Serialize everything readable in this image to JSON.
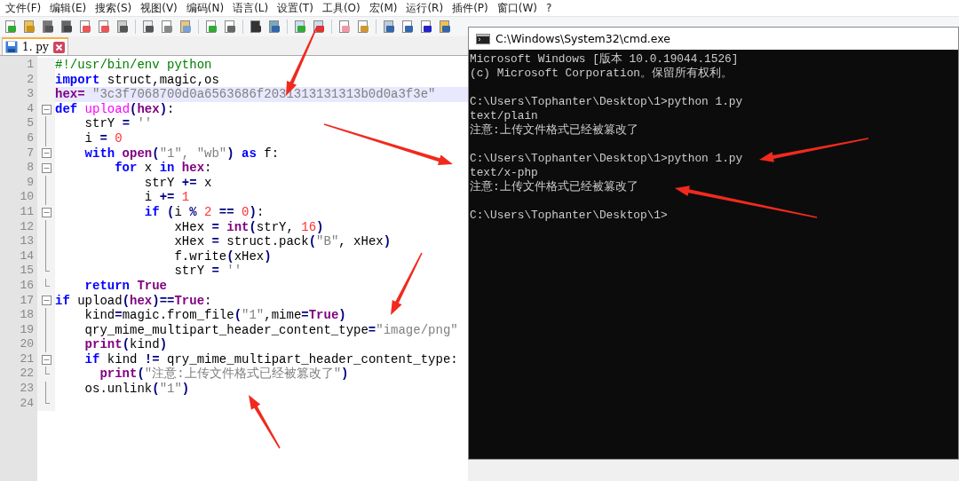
{
  "menu": [
    "文件(F)",
    "编辑(E)",
    "搜索(S)",
    "视图(V)",
    "编码(N)",
    "语言(L)",
    "设置(T)",
    "工具(O)",
    "宏(M)",
    "运行(R)",
    "插件(P)",
    "窗口(W)",
    "?"
  ],
  "tabs": [
    {
      "label": "1. py",
      "selected": true
    }
  ],
  "editor": {
    "lines": [
      {
        "number": "1",
        "fold_box": false,
        "fold_end": false,
        "selected": false,
        "tokens": [
          {
            "t": "#!/usr/bin/env python",
            "kind": "comment"
          }
        ]
      },
      {
        "number": "2",
        "fold_box": false,
        "fold_end": false,
        "selected": false,
        "tokens": [
          {
            "t": "import",
            "kind": "kw"
          },
          {
            "t": " struct,magic,os",
            "kind": "plain"
          }
        ]
      },
      {
        "number": "3",
        "fold_box": false,
        "fold_end": false,
        "selected": true,
        "tokens": [
          {
            "t": "hex=",
            "kind": "builtin"
          },
          {
            "t": " \"3c3f7068700d0a6563686f2031313131313b0d0a3f3e\"",
            "kind": "str"
          }
        ]
      },
      {
        "number": "4",
        "fold_box": true,
        "fold_end": false,
        "selected": false,
        "tokens": [
          {
            "t": "def",
            "kind": "kw"
          },
          {
            "t": " upload",
            "kind": "func"
          },
          {
            "t": "(",
            "kind": "op"
          },
          {
            "t": "hex",
            "kind": "builtin"
          },
          {
            "t": ")",
            "kind": "op"
          },
          {
            "t": ":",
            "kind": "plain"
          }
        ]
      },
      {
        "number": "5",
        "fold_box": false,
        "fold_end": false,
        "selected": false,
        "tokens": [
          {
            "t": "    strY ",
            "kind": "plain"
          },
          {
            "t": "=",
            "kind": "op"
          },
          {
            "t": " ''",
            "kind": "str"
          }
        ]
      },
      {
        "number": "6",
        "fold_box": false,
        "fold_end": false,
        "selected": false,
        "tokens": [
          {
            "t": "    i ",
            "kind": "plain"
          },
          {
            "t": "=",
            "kind": "op"
          },
          {
            "t": " 0",
            "kind": "num"
          }
        ]
      },
      {
        "number": "7",
        "fold_box": true,
        "fold_end": false,
        "selected": false,
        "tokens": [
          {
            "t": "    with",
            "kind": "kw"
          },
          {
            "t": " open",
            "kind": "builtin"
          },
          {
            "t": "(",
            "kind": "op"
          },
          {
            "t": "\"1\"",
            "kind": "str"
          },
          {
            "t": ", \"wb\"",
            "kind": "str"
          },
          {
            "t": ")",
            "kind": "op"
          },
          {
            "t": " as",
            "kind": "kw"
          },
          {
            "t": " f:",
            "kind": "plain"
          }
        ]
      },
      {
        "number": "8",
        "fold_box": true,
        "fold_end": false,
        "selected": false,
        "tokens": [
          {
            "t": "        for",
            "kind": "kw"
          },
          {
            "t": " x ",
            "kind": "plain"
          },
          {
            "t": "in",
            "kind": "kw"
          },
          {
            "t": " hex",
            "kind": "builtin"
          },
          {
            "t": ":",
            "kind": "plain"
          }
        ]
      },
      {
        "number": "9",
        "fold_box": false,
        "fold_end": false,
        "selected": false,
        "tokens": [
          {
            "t": "            strY ",
            "kind": "plain"
          },
          {
            "t": "+=",
            "kind": "op"
          },
          {
            "t": " x",
            "kind": "plain"
          }
        ]
      },
      {
        "number": "10",
        "fold_box": false,
        "fold_end": false,
        "selected": false,
        "tokens": [
          {
            "t": "            i ",
            "kind": "plain"
          },
          {
            "t": "+=",
            "kind": "op"
          },
          {
            "t": " 1",
            "kind": "num"
          }
        ]
      },
      {
        "number": "11",
        "fold_box": true,
        "fold_end": false,
        "selected": false,
        "tokens": [
          {
            "t": "            if",
            "kind": "kw"
          },
          {
            "t": " (",
            "kind": "op"
          },
          {
            "t": "i ",
            "kind": "plain"
          },
          {
            "t": "%",
            "kind": "op"
          },
          {
            "t": " 2",
            "kind": "num"
          },
          {
            "t": " ==",
            "kind": "op"
          },
          {
            "t": " 0",
            "kind": "num"
          },
          {
            "t": ")",
            "kind": "op"
          },
          {
            "t": ":",
            "kind": "plain"
          }
        ]
      },
      {
        "number": "12",
        "fold_box": false,
        "fold_end": false,
        "selected": false,
        "tokens": [
          {
            "t": "                xHex ",
            "kind": "plain"
          },
          {
            "t": "=",
            "kind": "op"
          },
          {
            "t": " int",
            "kind": "builtin"
          },
          {
            "t": "(",
            "kind": "op"
          },
          {
            "t": "strY, ",
            "kind": "plain"
          },
          {
            "t": "16",
            "kind": "num"
          },
          {
            "t": ")",
            "kind": "op"
          }
        ]
      },
      {
        "number": "13",
        "fold_box": false,
        "fold_end": false,
        "selected": false,
        "tokens": [
          {
            "t": "                xHex ",
            "kind": "plain"
          },
          {
            "t": "=",
            "kind": "op"
          },
          {
            "t": " struct.pack",
            "kind": "plain"
          },
          {
            "t": "(",
            "kind": "op"
          },
          {
            "t": "\"B\"",
            "kind": "str"
          },
          {
            "t": ", xHex",
            "kind": "plain"
          },
          {
            "t": ")",
            "kind": "op"
          }
        ]
      },
      {
        "number": "14",
        "fold_box": false,
        "fold_end": false,
        "selected": false,
        "tokens": [
          {
            "t": "                f.write",
            "kind": "plain"
          },
          {
            "t": "(",
            "kind": "op"
          },
          {
            "t": "xHex",
            "kind": "plain"
          },
          {
            "t": ")",
            "kind": "op"
          }
        ]
      },
      {
        "number": "15",
        "fold_box": false,
        "fold_end": true,
        "selected": false,
        "tokens": [
          {
            "t": "                strY ",
            "kind": "plain"
          },
          {
            "t": "=",
            "kind": "op"
          },
          {
            "t": " ''",
            "kind": "str"
          }
        ]
      },
      {
        "number": "16",
        "fold_box": false,
        "fold_end": true,
        "selected": false,
        "tokens": [
          {
            "t": "    return",
            "kind": "kw"
          },
          {
            "t": " True",
            "kind": "builtin"
          }
        ]
      },
      {
        "number": "17",
        "fold_box": true,
        "fold_end": false,
        "selected": false,
        "tokens": [
          {
            "t": "if",
            "kind": "kw"
          },
          {
            "t": " upload",
            "kind": "plain"
          },
          {
            "t": "(",
            "kind": "op"
          },
          {
            "t": "hex",
            "kind": "builtin"
          },
          {
            "t": ")",
            "kind": "op"
          },
          {
            "t": "==",
            "kind": "op"
          },
          {
            "t": "True",
            "kind": "builtin"
          },
          {
            "t": ":",
            "kind": "plain"
          }
        ]
      },
      {
        "number": "18",
        "fold_box": false,
        "fold_end": false,
        "selected": false,
        "tokens": [
          {
            "t": "    kind",
            "kind": "plain"
          },
          {
            "t": "=",
            "kind": "op"
          },
          {
            "t": "magic.from_file",
            "kind": "plain"
          },
          {
            "t": "(",
            "kind": "op"
          },
          {
            "t": "\"1\"",
            "kind": "str"
          },
          {
            "t": ",mime",
            "kind": "plain"
          },
          {
            "t": "=",
            "kind": "op"
          },
          {
            "t": "True",
            "kind": "builtin"
          },
          {
            "t": ")",
            "kind": "op"
          }
        ]
      },
      {
        "number": "19",
        "fold_box": false,
        "fold_end": false,
        "selected": false,
        "tokens": [
          {
            "t": "    qry_mime_multipart_header_content_type",
            "kind": "plain"
          },
          {
            "t": "=",
            "kind": "op"
          },
          {
            "t": "\"image/png\"",
            "kind": "str"
          }
        ]
      },
      {
        "number": "20",
        "fold_box": false,
        "fold_end": false,
        "selected": false,
        "tokens": [
          {
            "t": "    print",
            "kind": "builtin"
          },
          {
            "t": "(",
            "kind": "op"
          },
          {
            "t": "kind",
            "kind": "plain"
          },
          {
            "t": ")",
            "kind": "op"
          }
        ]
      },
      {
        "number": "21",
        "fold_box": true,
        "fold_end": false,
        "selected": false,
        "tokens": [
          {
            "t": "    if",
            "kind": "kw"
          },
          {
            "t": " kind ",
            "kind": "plain"
          },
          {
            "t": "!=",
            "kind": "op"
          },
          {
            "t": " qry_mime_multipart_header_content_type:",
            "kind": "plain"
          }
        ]
      },
      {
        "number": "22",
        "fold_box": false,
        "fold_end": true,
        "selected": false,
        "tokens": [
          {
            "t": "      print",
            "kind": "builtin"
          },
          {
            "t": "(",
            "kind": "op"
          },
          {
            "t": "\"注意:上传文件格式已经被篡改了\"",
            "kind": "str"
          },
          {
            "t": ")",
            "kind": "op"
          }
        ]
      },
      {
        "number": "23",
        "fold_box": false,
        "fold_end": false,
        "selected": false,
        "tokens": [
          {
            "t": "    os.unlink",
            "kind": "plain"
          },
          {
            "t": "(",
            "kind": "op"
          },
          {
            "t": "\"1\"",
            "kind": "str"
          },
          {
            "t": ")",
            "kind": "op"
          }
        ]
      },
      {
        "number": "24",
        "fold_box": false,
        "fold_end": true,
        "selected": false
      }
    ]
  },
  "console": {
    "title": "C:\\Windows\\System32\\cmd.exe",
    "blocks": [
      [
        "Microsoft Windows [版本 10.0.19044.1526]",
        "(c) Microsoft Corporation。保留所有权利。"
      ],
      [
        "C:\\Users\\Tophanter\\Desktop\\1>python 1.py",
        "text/plain",
        "注意:上传文件格式已经被篡改了"
      ],
      [
        "C:\\Users\\Tophanter\\Desktop\\1>python 1.py",
        "text/x-php",
        "注意:上传文件格式已经被篡改了"
      ],
      [
        "C:\\Users\\Tophanter\\Desktop\\1>"
      ]
    ]
  }
}
